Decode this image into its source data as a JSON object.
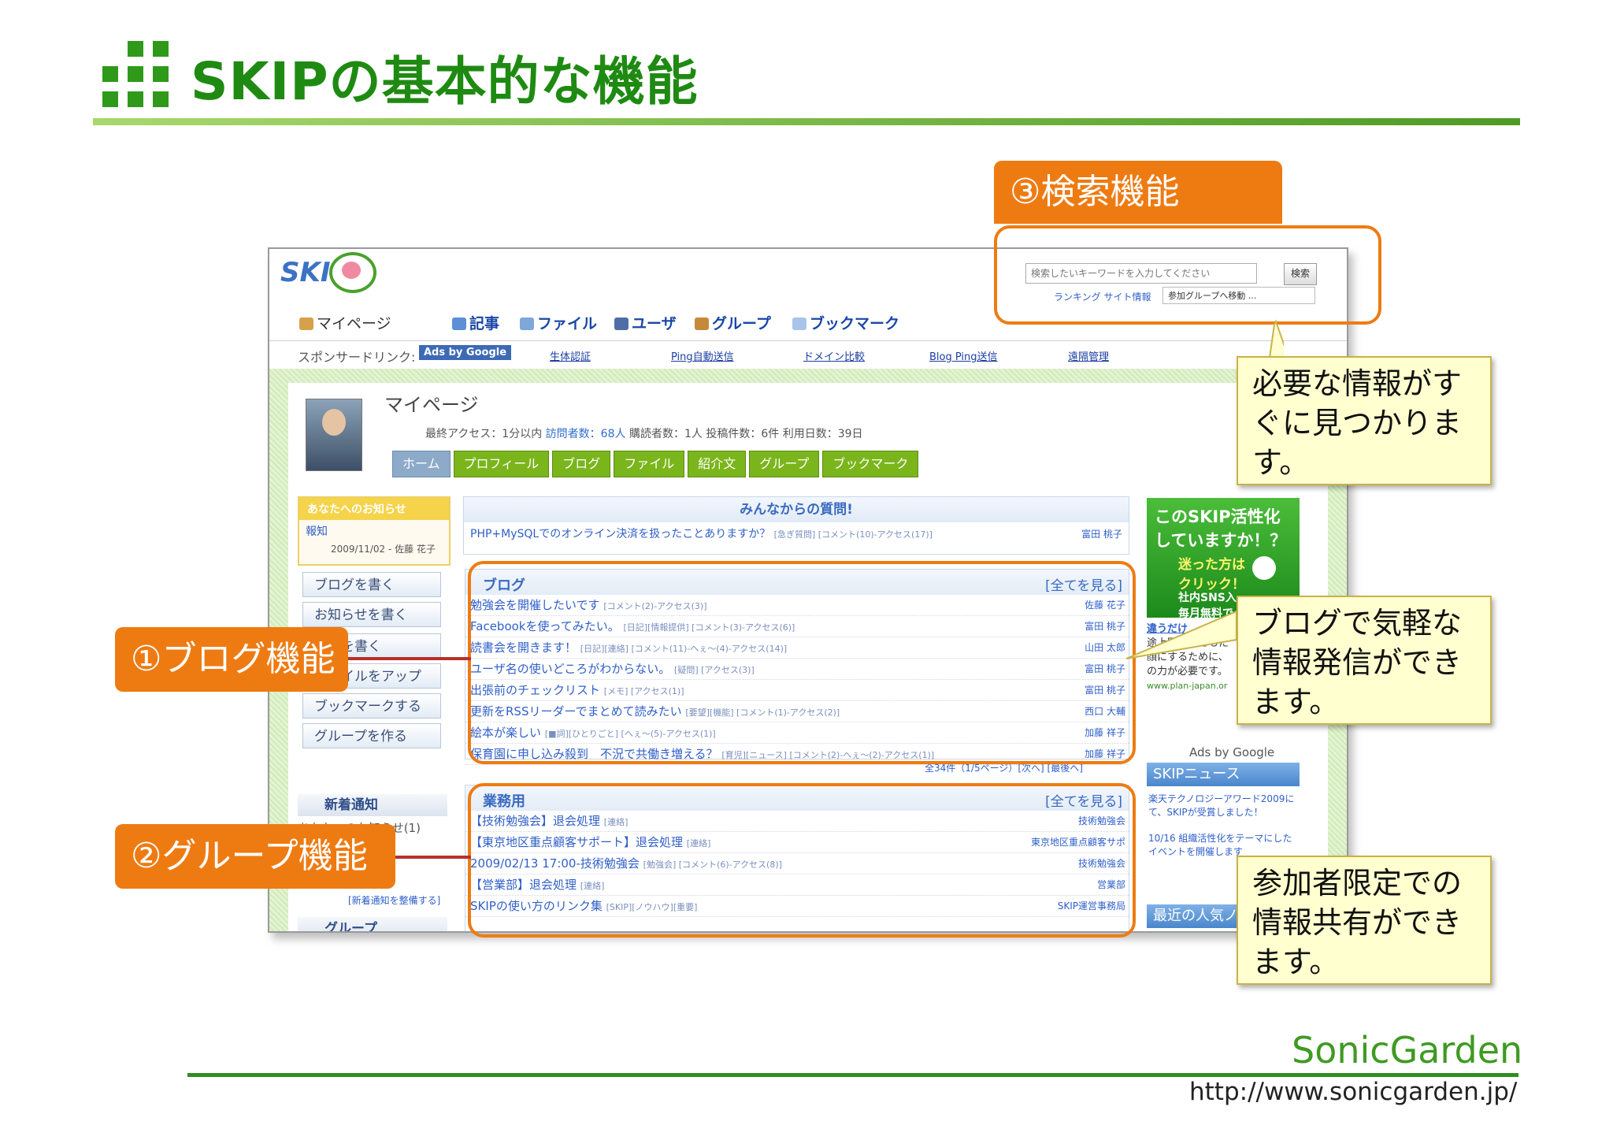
{
  "slide": {
    "title": "SKIPの基本的な機能",
    "footer_url": "http://www.sonicgarden.jp/",
    "footer_logo": "SonicGarden"
  },
  "app": {
    "logo_text": "SKI",
    "nav": {
      "mypage": "マイページ",
      "items": [
        "記事",
        "ファイル",
        "ユーザ",
        "グループ",
        "ブックマーク"
      ]
    },
    "search": {
      "placeholder": "検索したいキーワードを入力してください",
      "button": "検索",
      "links": "ランキング  サイト情報",
      "group_select": "参加グループへ移動 ..."
    },
    "sponsor": {
      "label": "スポンサードリンク:",
      "ads_badge": "Ads by Google",
      "links": [
        "生体認証",
        "Ping自動送信",
        "ドメイン比較",
        "Blog Ping送信",
        "遠隔管理"
      ]
    },
    "profile": {
      "heading": "マイページ",
      "stats_prefix": "最終アクセス：1分以内",
      "visitors": "訪問者数：68人",
      "subscribers": "購読者数：1人",
      "posts": "投稿件数：6件",
      "days": "利用日数：39日",
      "tabs": [
        "ホーム",
        "プロフィール",
        "ブログ",
        "ファイル",
        "紹介文",
        "グループ",
        "ブックマーク"
      ]
    },
    "notice": {
      "header": "あなたへのお知らせ",
      "item": "報知",
      "meta": "2009/11/02 - 佐藤 花子"
    },
    "sidebar_buttons": [
      "ブログを書く",
      "お知らせを書く",
      "質問を書く",
      "ファイルをアップ",
      "ブックマークする",
      "グループを作る"
    ],
    "new_arrivals": {
      "header": "新着通知",
      "text": "あなたへのお知らせ(1)",
      "setting": "[新着通知を整備する]"
    },
    "group_header": "グループ",
    "questions": {
      "header": "みんなからの質問!",
      "row": "PHP+MySQLでのオンライン決済を扱ったことありますか？",
      "row_meta": "[急ぎ質問]  [コメント(10)-アクセス(17)]",
      "author": "富田 桃子"
    },
    "blog": {
      "header": "ブログ",
      "see_all": "[全てを見る]",
      "rows": [
        {
          "title": "勉強会を開催したいです",
          "meta": "[コメント(2)-アクセス(3)]",
          "author": "佐藤 花子"
        },
        {
          "title": "Facebookを使ってみたい。",
          "meta": "[日記][情報提供] [コメント(3)-アクセス(6)]",
          "author": "富田 桃子"
        },
        {
          "title": "読書会を開きます！",
          "meta": "[日記][連絡] [コメント(11)-ヘぇ〜(4)-アクセス(14)]",
          "author": "山田 太郎"
        },
        {
          "title": "ユーザ名の使いどころがわからない。",
          "meta": "[疑問] [アクセス(3)]",
          "author": "富田 桃子"
        },
        {
          "title": "出張前のチェックリスト",
          "meta": "[メモ] [アクセス(1)]",
          "author": "富田 桃子"
        },
        {
          "title": "更新をRSSリーダーでまとめて読みたい",
          "meta": "[要望][機能] [コメント(1)-アクセス(2)]",
          "author": "西口 大輔"
        },
        {
          "title": "絵本が楽しい",
          "meta": "[■詞][ひとりごと] [ヘぇ〜(5)-アクセス(1)]",
          "author": "加藤 祥子"
        },
        {
          "title": "保育園に申し込み殺到　不況で共働き増える？",
          "meta": "[育児][ニュース] [コメント(2)-ヘぇ〜(2)-アクセス(1)]",
          "author": "加藤 祥子"
        }
      ],
      "pager": "全34件（1/5ページ）[次へ] [最後へ]"
    },
    "business": {
      "header": "業務用",
      "see_all": "[全てを見る]",
      "rows": [
        {
          "title": "【技術勉強会】退会処理",
          "meta": "[連絡]",
          "author": "技術勉強会"
        },
        {
          "title": "【東京地区重点顧客サポート】退会処理",
          "meta": "[連絡]",
          "author": "東京地区重点顧客サポ"
        },
        {
          "title": "2009/02/13 17:00-技術勉強会",
          "meta": "[勉強会] [コメント(6)-アクセス(8)]",
          "author": "技術勉強会"
        },
        {
          "title": "【営業部】退会処理",
          "meta": "[連絡]",
          "author": "営業部"
        },
        {
          "title": "SKIPの使い方のリンク集",
          "meta": "[SKIP][ノウハウ][重要]",
          "author": "SKIP運営事務局"
        }
      ]
    },
    "right_ad": {
      "line1": "このSKIP活性化",
      "line2": "していますか！？",
      "line3": "迷った方は",
      "line3b": "クリック！",
      "line4": "社内SNS入",
      "line5": "毎月無料で",
      "text": "違うだけ",
      "text2": "途上国の子どもた",
      "text3": "顔にするために、",
      "text4": "の力が必要です。",
      "text5": "www.plan-japan.or",
      "ads_by": "Ads by Google"
    },
    "skip_news": {
      "header": "SKIPニュース",
      "items": [
        "楽天テクノロジーアワード2009にて、SKIPが受賞しました！",
        "10/16 組織活性化をテーマにしたイベントを開催します"
      ]
    },
    "recent_header": "最近の人気ノ"
  },
  "annotations": {
    "search": "③検索機能",
    "blog": "①ブログ機能",
    "group": "②グループ機能",
    "callout_search": "必要な情報がすぐに見つかります。",
    "callout_blog": "ブログで気軽な情報発信ができます。",
    "callout_group": "参加者限定での情報共有ができます。"
  },
  "colors": {
    "title_green": "#1f8a12",
    "annotation_orange": "#ee7b12",
    "callout_bg": "#ffffcf",
    "connector_red": "#b8302a"
  }
}
